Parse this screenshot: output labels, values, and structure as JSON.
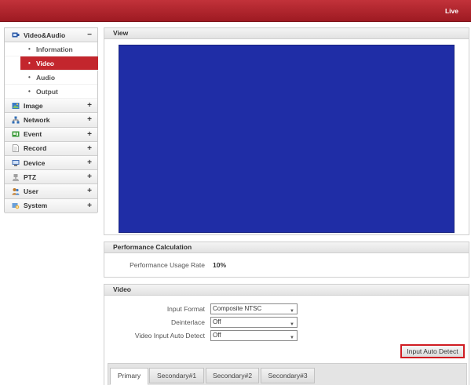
{
  "topbar": {
    "live_label": "Live"
  },
  "sidebar": {
    "items": [
      {
        "label": "Video&Audio",
        "sign": "−",
        "icon": "video-audio-icon",
        "color": "#2b5aa8"
      },
      {
        "label": "Image",
        "sign": "+",
        "icon": "image-icon",
        "color": "#3c7cc7"
      },
      {
        "label": "Network",
        "sign": "+",
        "icon": "network-icon",
        "color": "#2f6db5"
      },
      {
        "label": "Event",
        "sign": "+",
        "icon": "event-icon",
        "color": "#3a9a3a"
      },
      {
        "label": "Record",
        "sign": "+",
        "icon": "record-icon",
        "color": "#8a8a8a"
      },
      {
        "label": "Device",
        "sign": "+",
        "icon": "device-icon",
        "color": "#3a67b0"
      },
      {
        "label": "PTZ",
        "sign": "+",
        "icon": "ptz-icon",
        "color": "#a0a0a0"
      },
      {
        "label": "User",
        "sign": "+",
        "icon": "user-icon",
        "color": "#c07a2a"
      },
      {
        "label": "System",
        "sign": "+",
        "icon": "system-icon",
        "color": "#6a9fd8"
      }
    ],
    "subitems": [
      {
        "label": "Information"
      },
      {
        "label": "Video"
      },
      {
        "label": "Audio"
      },
      {
        "label": "Output"
      }
    ],
    "bullet": "•"
  },
  "view": {
    "title": "View",
    "canvas_color": "#1f2da6"
  },
  "performance": {
    "title": "Performance Calculation",
    "label": "Performance Usage Rate",
    "value": "10%"
  },
  "video": {
    "title": "Video",
    "input_format": {
      "label": "Input Format",
      "value": "Composite NTSC"
    },
    "deinterlace": {
      "label": "Deinterlace",
      "value": "Off"
    },
    "auto_detect": {
      "label": "Video Input Auto Detect",
      "value": "Off"
    },
    "auto_detect_button": "Input Auto Detect",
    "tabs": [
      "Primary",
      "Secondary#1",
      "Secondary#2",
      "Secondary#3"
    ]
  },
  "colors": {
    "brand": "#b3232b",
    "active": "#c3262d"
  }
}
